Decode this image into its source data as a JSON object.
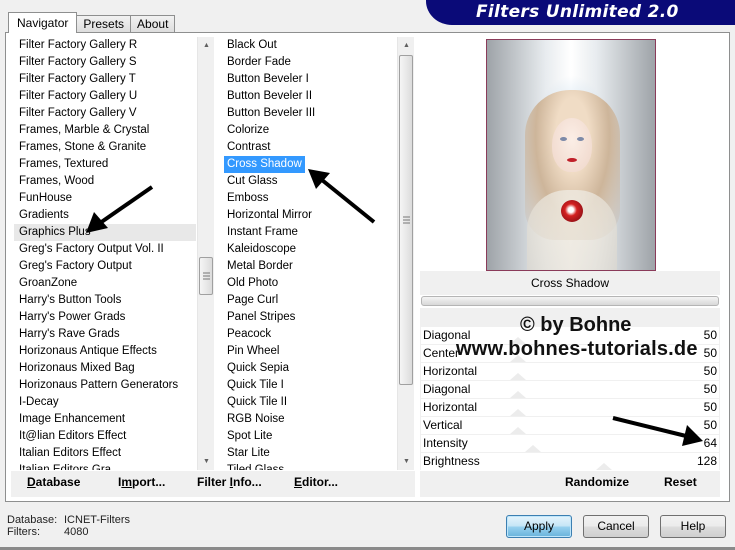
{
  "banner": {
    "title": "Filters Unlimited 2.0"
  },
  "tabs": [
    {
      "label": "Navigator",
      "active": true
    },
    {
      "label": "Presets",
      "active": false
    },
    {
      "label": "About",
      "active": false
    }
  ],
  "categories": {
    "items": [
      "Filter Factory Gallery R",
      "Filter Factory Gallery S",
      "Filter Factory Gallery T",
      "Filter Factory Gallery U",
      "Filter Factory Gallery V",
      "Frames, Marble & Crystal",
      "Frames, Stone & Granite",
      "Frames, Textured",
      "Frames, Wood",
      "FunHouse",
      "Gradients",
      "Graphics Plus",
      "Greg's Factory Output Vol. II",
      "Greg's Factory Output",
      "GroanZone",
      "Harry's Button Tools",
      "Harry's Power Grads",
      "Harry's Rave Grads",
      "Horizonaus Antique Effects",
      "Horizonaus Mixed Bag",
      "Horizonaus Pattern Generators",
      "I-Decay",
      "Image Enhancement",
      "It@lian Editors Effect",
      "Italian Editors Effect",
      "Italian Editors Gra..."
    ],
    "highlighted": "Graphics Plus"
  },
  "filters": {
    "items": [
      "Black Out",
      "Border Fade",
      "Button Beveler I",
      "Button Beveler II",
      "Button Beveler III",
      "Colorize",
      "Contrast",
      "Cross Shadow",
      "Cut Glass",
      "Emboss",
      "Horizontal Mirror",
      "Instant Frame",
      "Kaleidoscope",
      "Metal Border",
      "Old Photo",
      "Page Curl",
      "Panel Stripes",
      "Peacock",
      "Pin Wheel",
      "Quick Sepia",
      "Quick Tile I",
      "Quick Tile II",
      "RGB Noise",
      "Spot Lite",
      "Star Lite",
      "Tiled Glass..."
    ],
    "selected": "Cross Shadow"
  },
  "left_buttons": {
    "database": {
      "pre": "",
      "u": "D",
      "post": "atabase"
    },
    "import": {
      "pre": "I",
      "u": "m",
      "post": "port..."
    },
    "filter_info": {
      "pre": "Filter ",
      "u": "I",
      "post": "nfo..."
    },
    "editor": {
      "pre": "",
      "u": "E",
      "post": "ditor..."
    }
  },
  "preview": {
    "filter_name": "Cross Shadow",
    "progress": 0
  },
  "watermark": {
    "line1": "© by Bohne",
    "line2": "www.bohnes-tutorials.de"
  },
  "parameters": [
    {
      "label": "Diagonal",
      "value": "50",
      "max": 255
    },
    {
      "label": "Center",
      "value": "50",
      "max": 255
    },
    {
      "label": "Horizontal",
      "value": "50",
      "max": 255
    },
    {
      "label": "Diagonal",
      "value": "50",
      "max": 255
    },
    {
      "label": "Horizontal",
      "value": "50",
      "max": 255
    },
    {
      "label": "Vertical",
      "value": "50",
      "max": 255
    },
    {
      "label": "Intensity",
      "value": "64",
      "max": 255
    },
    {
      "label": "Brightness",
      "value": "128",
      "max": 255
    }
  ],
  "right_buttons": {
    "randomize": "Randomize",
    "reset": "Reset"
  },
  "status": {
    "database_key": "Database:",
    "database_value": "ICNET-Filters",
    "filters_key": "Filters:",
    "filters_value": "4080"
  },
  "dialog_buttons": {
    "apply": "Apply",
    "cancel": "Cancel",
    "help": "Help"
  },
  "scroll": {
    "categories_position": 0.55,
    "filters_position": 0.0
  }
}
